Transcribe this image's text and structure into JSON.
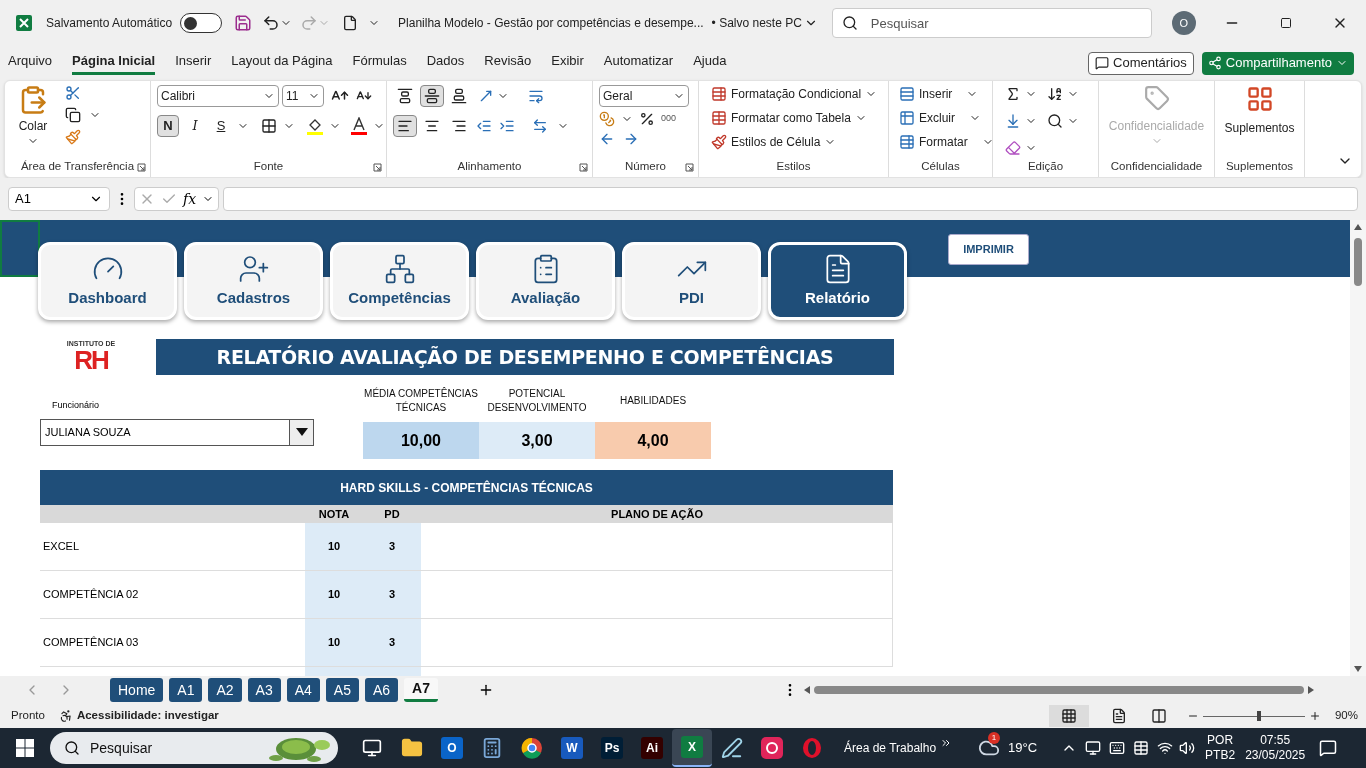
{
  "titlebar": {
    "autosave_label": "Salvamento Automático",
    "autosave_on": false,
    "title": "Planilha Modelo - Gestão por competências e desempe...",
    "save_status": "• Salvo neste PC",
    "search_placeholder": "Pesquisar",
    "avatar": "O"
  },
  "menu": {
    "tabs": [
      {
        "label": "Arquivo",
        "selected": false
      },
      {
        "label": "Página Inicial",
        "selected": true
      },
      {
        "label": "Inserir",
        "selected": false
      },
      {
        "label": "Layout da Página",
        "selected": false
      },
      {
        "label": "Fórmulas",
        "selected": false
      },
      {
        "label": "Dados",
        "selected": false
      },
      {
        "label": "Revisão",
        "selected": false
      },
      {
        "label": "Exibir",
        "selected": false
      },
      {
        "label": "Automatizar",
        "selected": false
      },
      {
        "label": "Ajuda",
        "selected": false
      }
    ],
    "comments": "Comentários",
    "share": "Compartilhamento"
  },
  "ribbon": {
    "groups": [
      "Área de Transferência",
      "Fonte",
      "Alinhamento",
      "Número",
      "Estilos",
      "Células",
      "Edição",
      "Confidencialidade",
      "Suplementos"
    ],
    "paste": "Colar",
    "font_name": "Calibri",
    "font_size": "11",
    "bold": {
      "label": "N",
      "selected": true
    },
    "italic": "I",
    "underline": "S",
    "vertical_align": [
      {
        "selected": false
      },
      {
        "selected": true
      },
      {
        "selected": false
      }
    ],
    "horizontal_align": [
      {
        "selected": true
      },
      {
        "selected": false
      },
      {
        "selected": false
      }
    ],
    "number_format": "Geral",
    "thousands": "000",
    "styles": [
      "Formatação Condicional",
      "Formatar como Tabela",
      "Estilos de Célula"
    ],
    "cells": [
      "Inserir",
      "Excluir",
      "Formatar"
    ],
    "sensitivity": {
      "label": "Confidencialidade",
      "disabled": true
    },
    "addins": "Suplementos"
  },
  "formula_bar": {
    "name_box": "A1",
    "fx": "fx"
  },
  "sheet": {
    "nav": [
      {
        "label": "Dashboard",
        "selected": false
      },
      {
        "label": "Cadastros",
        "selected": false
      },
      {
        "label": "Competências",
        "selected": false
      },
      {
        "label": "Avaliação",
        "selected": false
      },
      {
        "label": "PDI",
        "selected": false
      },
      {
        "label": "Relatório",
        "selected": true
      }
    ],
    "print": "IMPRIMIR",
    "logo_top": "INSTITUTO DE",
    "logo_main": "RH",
    "title": "RELATÓRIO AVALIAÇÃO DE DESEMPENHO E COMPETÊNCIAS",
    "employee_label": "Funcionário",
    "employee": "JULIANA SOUZA",
    "metrics": [
      {
        "label": "MÉDIA COMPETÊNCIAS TÉCNICAS",
        "value": "10,00",
        "color": "#bdd7ee"
      },
      {
        "label": "POTENCIAL DESENVOLVIMENTO",
        "value": "3,00",
        "color": "#ddebf7"
      },
      {
        "label": "HABILIDADES",
        "value": "4,00",
        "color": "#f8cbad"
      }
    ],
    "table": {
      "title": "HARD SKILLS - COMPETÊNCIAS TÉCNICAS",
      "columns": [
        "NOTA",
        "PD",
        "PLANO DE AÇÃO"
      ],
      "rows": [
        {
          "name": "EXCEL",
          "nota": "10",
          "pd": "3"
        },
        {
          "name": "COMPETÊNCIA 02",
          "nota": "10",
          "pd": "3"
        },
        {
          "name": "COMPETÊNCIA 03",
          "nota": "10",
          "pd": "3"
        }
      ]
    }
  },
  "sheet_tabs": [
    {
      "label": "Home",
      "selected": false
    },
    {
      "label": "A1",
      "selected": false
    },
    {
      "label": "A2",
      "selected": false
    },
    {
      "label": "A3",
      "selected": false
    },
    {
      "label": "A4",
      "selected": false
    },
    {
      "label": "A5",
      "selected": false
    },
    {
      "label": "A6",
      "selected": false
    },
    {
      "label": "A7",
      "selected": true
    }
  ],
  "status_bar": {
    "ready": "Pronto",
    "accessibility": "Acessibilidade: investigar",
    "zoom": {
      "level": 0.55
    },
    "zoom_text": "90%"
  },
  "taskbar": {
    "search": "Pesquisar",
    "apps": [
      {
        "kind": "taskview",
        "selected": false
      },
      {
        "kind": "folder",
        "selected": false
      },
      {
        "kind": "tile",
        "glyph": "O",
        "color": "#0a64c8",
        "selected": false
      },
      {
        "kind": "calc",
        "selected": false
      },
      {
        "kind": "chrome",
        "selected": false
      },
      {
        "kind": "tile",
        "glyph": "W",
        "color": "#185abd",
        "selected": false
      },
      {
        "kind": "tile",
        "glyph": "Ps",
        "color": "#001e36",
        "selected": false
      },
      {
        "kind": "tile",
        "glyph": "Ai",
        "color": "#330000",
        "selected": false
      },
      {
        "kind": "tile",
        "glyph": "X",
        "color": "#107c41",
        "selected": true
      },
      {
        "kind": "pen",
        "selected": false
      },
      {
        "kind": "cc",
        "selected": false
      },
      {
        "kind": "opera",
        "selected": false
      }
    ],
    "desktop": "Área de Trabalho",
    "weather_badge": "1",
    "temperature": "19°C",
    "lang_top": "POR",
    "lang_bottom": "PTB2",
    "time": "07:55",
    "date": "23/05/2025"
  }
}
